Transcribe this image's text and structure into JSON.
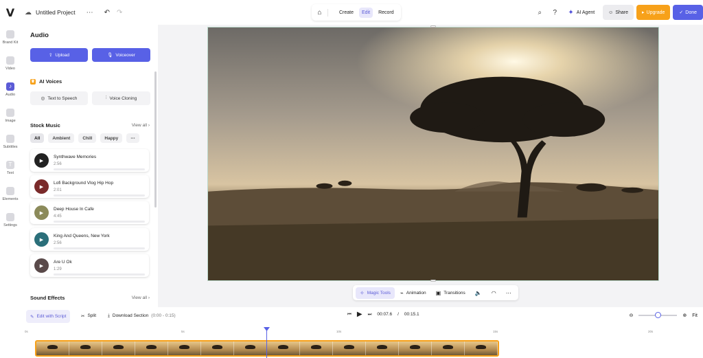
{
  "app": {
    "logo": "V",
    "project_title": "Untitled Project",
    "more": "⋯"
  },
  "top_modes": [
    "Create",
    "Edit",
    "Record"
  ],
  "active_mode": "Edit",
  "top_right": {
    "ai_agent": "AI Agent",
    "share": "Share",
    "upgrade": "Upgrade",
    "done": "Done"
  },
  "rail": [
    {
      "label": "Brand Kit",
      "icon": "brand-kit-icon"
    },
    {
      "label": "Video",
      "icon": "video-icon"
    },
    {
      "label": "Audio",
      "icon": "audio-icon"
    },
    {
      "label": "Image",
      "icon": "image-icon"
    },
    {
      "label": "Subtitles",
      "icon": "subtitles-icon"
    },
    {
      "label": "Text",
      "icon": "text-icon"
    },
    {
      "label": "Elements",
      "icon": "elements-icon"
    },
    {
      "label": "Settings",
      "icon": "settings-icon"
    }
  ],
  "panel": {
    "title": "Audio",
    "upload": "Upload",
    "voiceover": "Voiceover",
    "ai_voices": "AI Voices",
    "text_to_speech": "Text to Speech",
    "voice_cloning": "Voice Cloning",
    "stock_music": "Stock Music",
    "view_all": "View all",
    "chips": [
      "All",
      "Ambient",
      "Chill",
      "Happy",
      "⋯"
    ],
    "tracks": [
      {
        "name": "Synthwave Memories",
        "duration": "2:56"
      },
      {
        "name": "Lofi Background Vlog Hip Hop",
        "duration": "2:01"
      },
      {
        "name": "Deep House In Cafe",
        "duration": "4:45"
      },
      {
        "name": "King And Queens, New York",
        "duration": "2:56"
      },
      {
        "name": "Are U Ok",
        "duration": "1:29"
      }
    ],
    "sound_effects": "Sound Effects",
    "view_all_2": "View all"
  },
  "toolbar": {
    "magic_tools": "Magic Tools",
    "animation": "Animation",
    "transitions": "Transitions"
  },
  "timeline": {
    "edit_with_script": "Edit with Script",
    "split": "Split",
    "download_section": "Download Section",
    "range": "(0:00 - 0:15)",
    "current_time": "00:07.6",
    "separator": "/",
    "total_time": "00:15.1",
    "fit": "Fit",
    "zoom_level": 0.5,
    "ticks": [
      "0s",
      "5s",
      "10s",
      "15s",
      "20s"
    ]
  },
  "colors": {
    "accent": "#5861e6",
    "upgrade": "#f7a11a",
    "clip_border": "#f7a11a"
  }
}
